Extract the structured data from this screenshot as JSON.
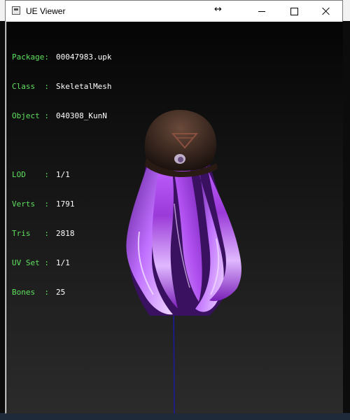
{
  "window": {
    "title": "UE Viewer",
    "resize_glyph": "↔"
  },
  "info": {
    "package_key": "Package:",
    "package_val": "00047983.upk",
    "class_key": "Class  :",
    "class_val": "SkeletalMesh",
    "object_key": "Object :",
    "object_val": "040308_KunN",
    "lod_key": "LOD    :",
    "lod_val": "1/1",
    "verts_key": "Verts  :",
    "verts_val": "1791",
    "tris_key": "Tris   :",
    "tris_val": "2818",
    "uvset_key": "UV Set :",
    "uvset_val": "1/1",
    "bones_key": "Bones  :",
    "bones_val": "25"
  },
  "colors": {
    "info_key": "#5ee05e",
    "info_value": "#ffffff",
    "bone_line": "#1a1aa0",
    "hair_purple": "#a040e0"
  },
  "icons": {
    "app": "app-icon",
    "minimize": "minimize-icon",
    "maximize": "maximize-icon",
    "close": "close-icon",
    "resize": "resize-arrows-icon"
  }
}
